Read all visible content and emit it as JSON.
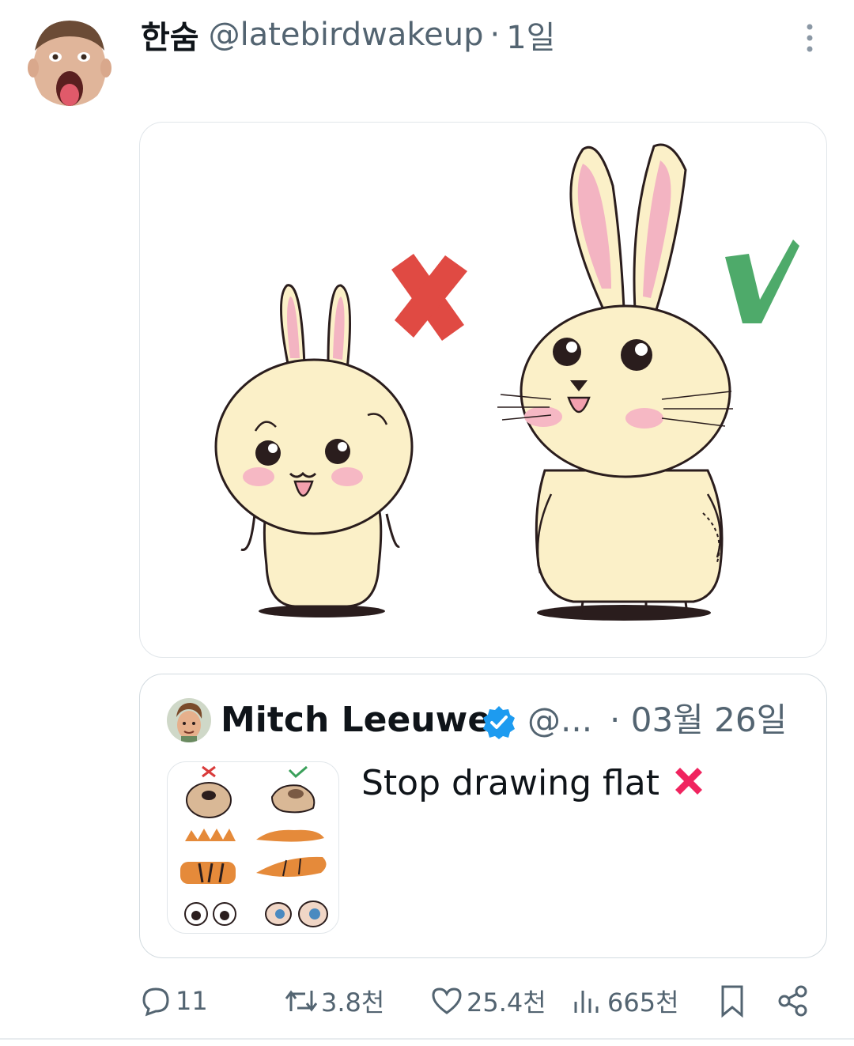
{
  "tweet": {
    "display_name": "한숨",
    "handle": "@latebirdwakeup",
    "separator": "·",
    "time": "1일",
    "avatar_icon": "user-avatar-photo",
    "more_icon": "more-vertical-icon"
  },
  "media": {
    "icon": "bunny-comparison-illustration"
  },
  "quote": {
    "display_name": "Mitch Leeuwe",
    "handle": "@...",
    "separator": "·",
    "time": "03월 26일",
    "text": "Stop drawing flat",
    "verified_icon": "verified-badge-icon",
    "emoji_icon": "cross-mark-emoji-icon"
  },
  "actions": {
    "replies": "11",
    "retweets": "3.8천",
    "likes": "25.4천",
    "views": "665천"
  },
  "colors": {
    "verified_blue": "#1d9bf0",
    "text_secondary": "#536471",
    "cross_red": "#e04a43",
    "check_green": "#4eaa6a",
    "bunny_cream": "#fbf0c8",
    "ear_pink": "#f3b4c2"
  }
}
